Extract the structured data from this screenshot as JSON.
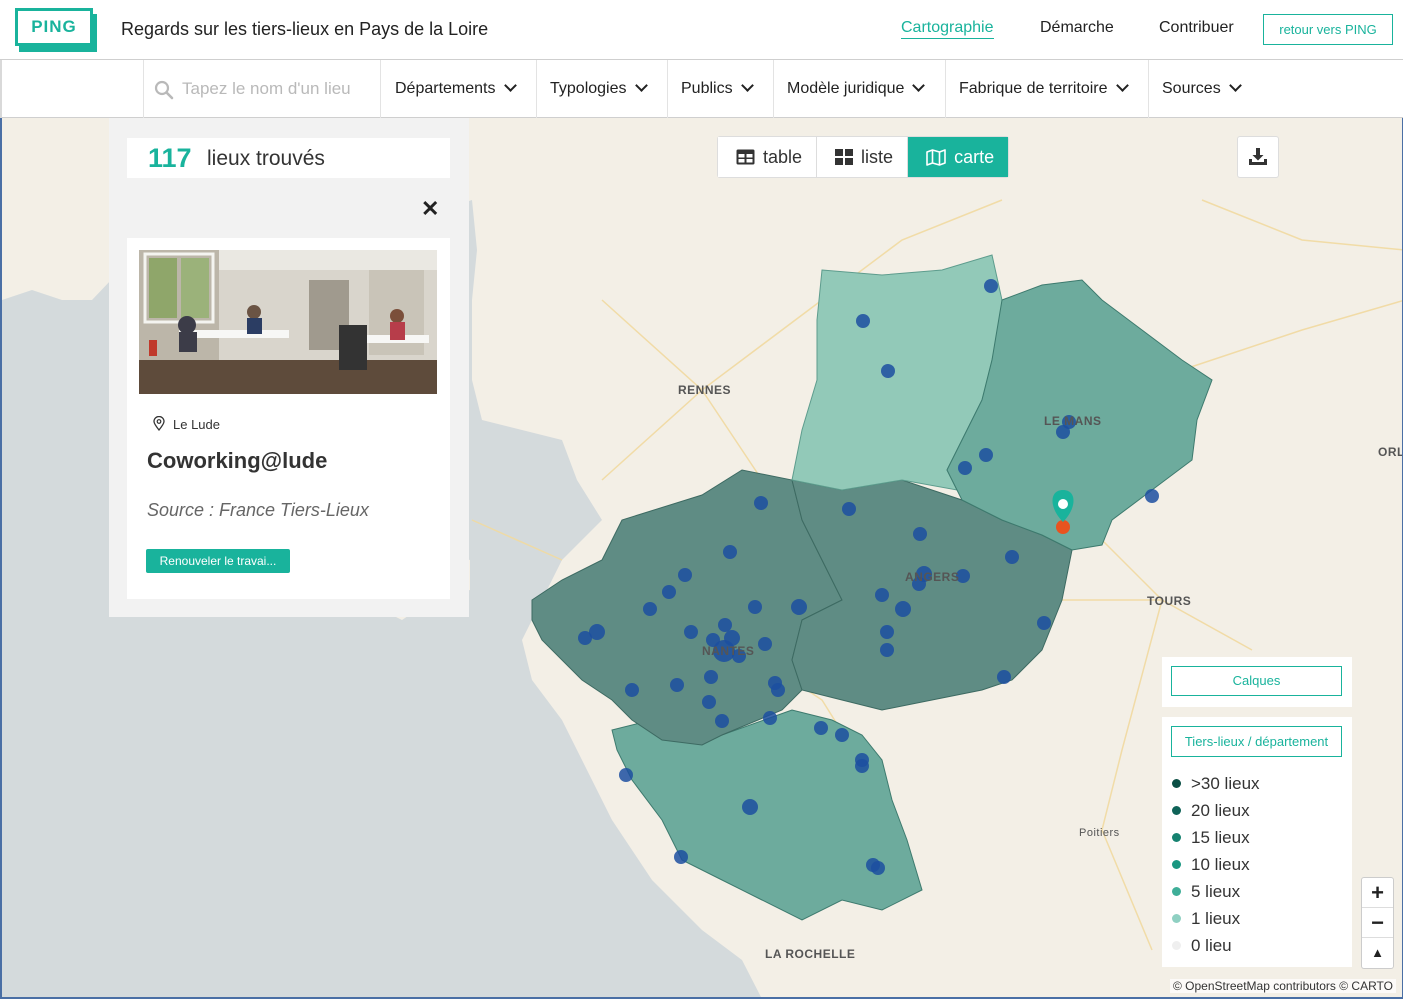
{
  "header": {
    "logo_text": "PING",
    "site_title": "Regards sur les tiers-lieux en Pays de la Loire",
    "nav": [
      "Cartographie",
      "Démarche",
      "Contribuer"
    ],
    "back_button": "retour vers PING"
  },
  "filters": {
    "search_placeholder": "Tapez le nom d'un lieu",
    "items": [
      "Départements",
      "Typologies",
      "Publics",
      "Modèle juridique",
      "Fabrique de territoire",
      "Sources"
    ]
  },
  "results": {
    "count": "117",
    "label": "lieux trouvés"
  },
  "selected_place": {
    "town": "Le Lude",
    "name": "Coworking@lude",
    "source": "Source : France Tiers-Lieux",
    "button": "Renouveler le travai..."
  },
  "views": {
    "table": "table",
    "list": "liste",
    "map": "carte",
    "active": "carte"
  },
  "map": {
    "cities": [
      "RENNES",
      "LE MANS",
      "ANGERS",
      "NANTES",
      "TOURS",
      "Poitiers",
      "LA ROCHELLE",
      "ORL"
    ],
    "layers_button": "Calques",
    "legend_button": "Tiers-lieux / département",
    "legend": [
      {
        "label": ">30 lieux",
        "color": "#0b4f45"
      },
      {
        "label": "20 lieux",
        "color": "#0f6358"
      },
      {
        "label": "15 lieux",
        "color": "#168270"
      },
      {
        "label": "10 lieux",
        "color": "#1a9781"
      },
      {
        "label": "5 lieux",
        "color": "#3fae98"
      },
      {
        "label": "1 lieux",
        "color": "#8fd0c2"
      },
      {
        "label": "0 lieu",
        "color": "#efefef"
      }
    ],
    "zoom_in": "+",
    "zoom_out": "−",
    "reset_north": "▲",
    "attribution": "© OpenStreetMap contributors © CARTO"
  },
  "colors": {
    "accent": "#19b39c",
    "dept_dark": "#5f8c84",
    "dept_mid": "#6dab9d",
    "dept_light": "#92c9b8",
    "marker": "#1c4fa0"
  }
}
